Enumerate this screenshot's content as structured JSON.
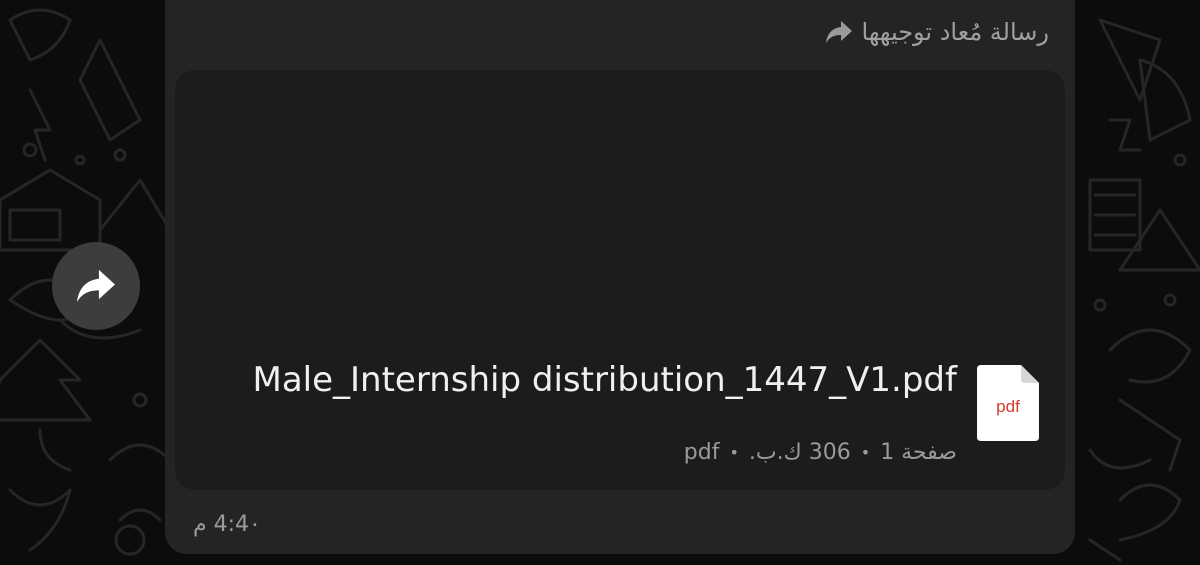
{
  "message": {
    "forwarded_label": "رسالة مُعاد توجيهها",
    "file_name": "Male_Internship distribution_1447_V1.pdf",
    "file_icon_label": "pdf",
    "pages": "صفحة 1",
    "size": "306 ك.ب.",
    "type": "pdf",
    "timestamp": "4:4٠ م"
  },
  "icons": {
    "forwarded": "forward-arrow-icon",
    "file": "pdf-file-icon",
    "forward_button": "forward-arrow-icon"
  },
  "colors": {
    "bubble": "#232424",
    "document_card": "#1b1c1c",
    "pdf_accent": "#d23b2e",
    "forward_button": "#3c3d3e"
  }
}
